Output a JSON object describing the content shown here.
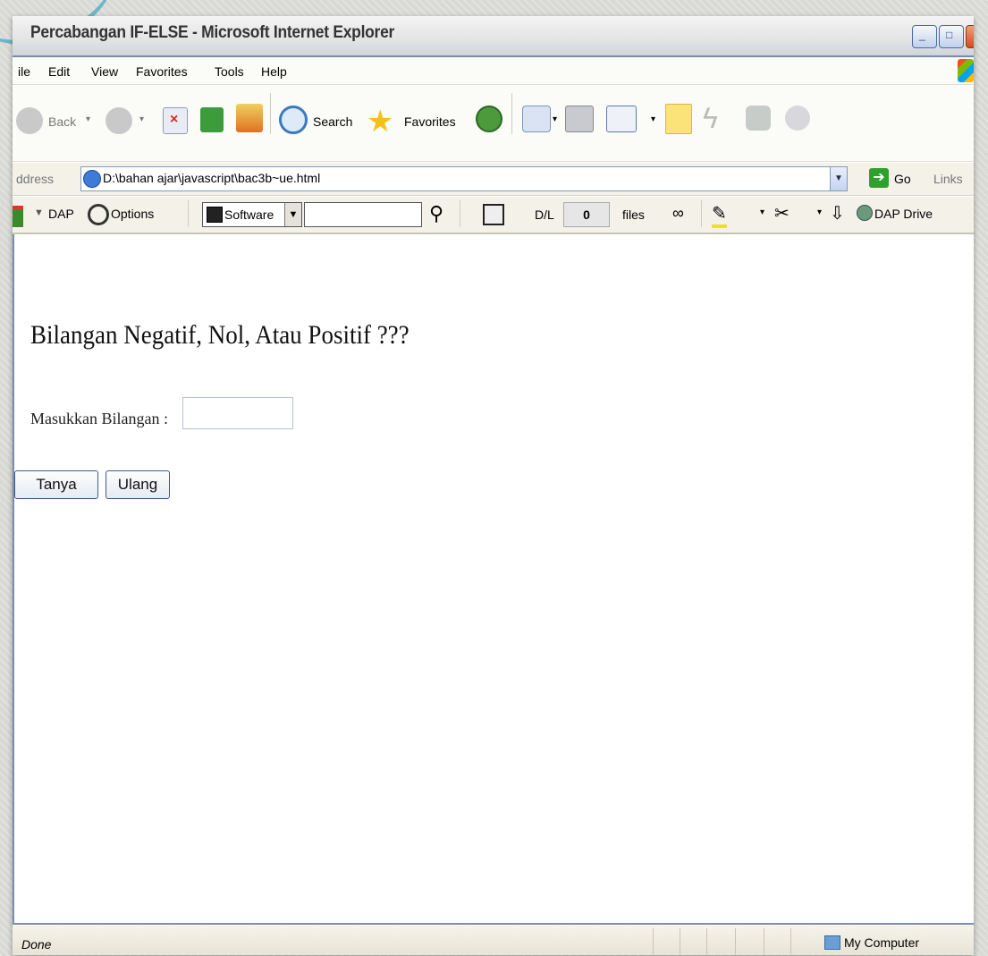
{
  "window": {
    "title": "Percabangan IF-ELSE - Microsoft Internet Explorer",
    "min_label": "_",
    "max_label": "□"
  },
  "menu": [
    "ile",
    "Edit",
    "View",
    "Favorites",
    "Tools",
    "Help"
  ],
  "toolbar": {
    "back": "Back",
    "search": "Search",
    "favorites": "Favorites"
  },
  "address": {
    "label": "ddress",
    "url": "D:\\bahan ajar\\javascript\\bac3b~ue.html",
    "go": "Go",
    "links": "Links"
  },
  "dap": {
    "dap_label": "DAP",
    "options_label": "Options",
    "software_label": "Software",
    "dl_label": "D/L",
    "dl_count": "0",
    "files_label": "files",
    "drive_label": "DAP Drive"
  },
  "page": {
    "heading": "Bilangan Negatif, Nol, Atau Positif ???",
    "input_label": "Masukkan Bilangan :",
    "input_value": "",
    "ask_button": "Tanya",
    "reset_button": "Ulang"
  },
  "status": {
    "text": "Done",
    "zone": "My Computer"
  }
}
